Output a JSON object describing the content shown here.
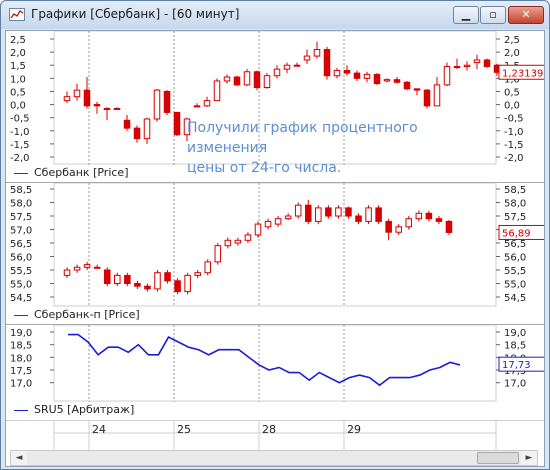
{
  "window": {
    "title": "Графики [Сбербанк] - [60 минут]",
    "minimize_glyph": "▁",
    "maximize_glyph": "▫",
    "close_glyph": "✕"
  },
  "annotation": {
    "line1": "Получили график процентного изменения",
    "line2": "цены от 24-го числа."
  },
  "colors": {
    "candle": "#d80000",
    "line": "#1c1cd8",
    "annotation": "#5b8fd6"
  },
  "time_axis": {
    "labels": [
      "24",
      "25",
      "28",
      "29"
    ]
  },
  "scroll": {
    "left_arrow": "◄",
    "right_arrow": "►"
  },
  "chart_data": [
    {
      "type": "candlestick",
      "legend": "Сбербанк [Price]",
      "last_value": "1,231394",
      "yticks": [
        "2,5",
        "2,0",
        "1,5",
        "1,0",
        "0,5",
        "0,0",
        "-0,5",
        "-1,0",
        "-1,5",
        "-2,0"
      ],
      "ylim": [
        -2.0,
        2.5
      ],
      "candles": [
        [
          0.15,
          0.3,
          0.5,
          0.05
        ],
        [
          0.3,
          0.55,
          0.8,
          0.15
        ],
        [
          0.55,
          -0.05,
          1.05,
          -0.15
        ],
        [
          0.0,
          -0.05,
          0.1,
          -0.35
        ],
        [
          -0.15,
          -0.15,
          -0.1,
          -0.6
        ],
        [
          -0.15,
          -0.15,
          -0.1,
          -0.15
        ],
        [
          -0.6,
          -0.9,
          -0.4,
          -1.0
        ],
        [
          -0.9,
          -1.3,
          -0.8,
          -1.45
        ],
        [
          -1.3,
          -0.55,
          -0.5,
          -1.5
        ],
        [
          -0.55,
          0.55,
          0.6,
          -0.65
        ],
        [
          0.5,
          -0.3,
          0.55,
          -0.4
        ],
        [
          -0.3,
          -1.15,
          -0.3,
          -1.2
        ],
        [
          -1.15,
          -0.55,
          -0.5,
          -1.4
        ],
        [
          -0.05,
          -0.05,
          0.05,
          -0.1
        ],
        [
          -0.05,
          0.15,
          0.3,
          -0.1
        ],
        [
          0.15,
          0.9,
          1.0,
          0.15
        ],
        [
          0.9,
          1.05,
          1.15,
          0.8
        ],
        [
          1.05,
          0.75,
          1.1,
          0.7
        ],
        [
          0.75,
          1.25,
          1.35,
          0.7
        ],
        [
          1.25,
          0.65,
          1.3,
          0.55
        ],
        [
          0.65,
          1.1,
          1.2,
          0.6
        ],
        [
          1.1,
          1.35,
          1.5,
          1.0
        ],
        [
          1.35,
          1.5,
          1.6,
          1.2
        ],
        [
          1.5,
          1.5,
          1.6,
          1.45
        ],
        [
          1.7,
          1.85,
          2.1,
          1.55
        ],
        [
          1.85,
          2.1,
          2.4,
          1.75
        ],
        [
          2.1,
          1.1,
          2.2,
          0.95
        ],
        [
          1.1,
          1.3,
          1.4,
          1.0
        ],
        [
          1.3,
          1.2,
          1.5,
          1.1
        ],
        [
          1.2,
          1.0,
          1.3,
          0.9
        ],
        [
          1.0,
          1.15,
          1.25,
          0.85
        ],
        [
          1.15,
          0.8,
          1.2,
          0.75
        ],
        [
          0.9,
          0.95,
          1.0,
          0.85
        ],
        [
          0.95,
          0.85,
          1.05,
          0.8
        ],
        [
          0.85,
          0.6,
          0.9,
          0.55
        ],
        [
          0.6,
          0.55,
          0.6,
          0.35
        ],
        [
          0.55,
          -0.05,
          0.6,
          -0.15
        ],
        [
          -0.05,
          0.75,
          1.05,
          -0.05
        ],
        [
          0.75,
          1.45,
          1.6,
          0.7
        ],
        [
          1.45,
          1.45,
          1.75,
          1.35
        ],
        [
          1.45,
          1.5,
          1.65,
          1.3
        ],
        [
          1.6,
          1.7,
          1.9,
          1.35
        ],
        [
          1.7,
          1.45,
          1.75,
          1.4
        ],
        [
          1.5,
          1.23,
          1.55,
          1.1
        ]
      ]
    },
    {
      "type": "candlestick",
      "legend": "Сбербанк-п [Price]",
      "last_value": "56,89",
      "yticks": [
        "58,5",
        "58,0",
        "57,5",
        "57,0",
        "56,5",
        "56,0",
        "55,5",
        "55,0",
        "54,5"
      ],
      "ylim": [
        54.5,
        58.5
      ],
      "candles": [
        [
          55.3,
          55.5,
          55.6,
          55.2
        ],
        [
          55.5,
          55.6,
          55.7,
          55.4
        ],
        [
          55.6,
          55.7,
          55.8,
          55.5
        ],
        [
          55.6,
          55.6,
          55.7,
          55.55
        ],
        [
          55.5,
          55.0,
          55.6,
          54.9
        ],
        [
          55.0,
          55.3,
          55.4,
          54.9
        ],
        [
          55.3,
          55.0,
          55.4,
          54.9
        ],
        [
          55.0,
          54.9,
          55.1,
          54.8
        ],
        [
          54.9,
          54.8,
          55.0,
          54.7
        ],
        [
          54.8,
          55.4,
          55.5,
          54.7
        ],
        [
          55.4,
          55.1,
          55.5,
          55.0
        ],
        [
          55.1,
          54.7,
          55.2,
          54.6
        ],
        [
          54.7,
          55.3,
          55.4,
          54.6
        ],
        [
          55.3,
          55.4,
          55.5,
          55.2
        ],
        [
          55.4,
          55.8,
          55.9,
          55.3
        ],
        [
          55.8,
          56.4,
          56.5,
          55.7
        ],
        [
          56.4,
          56.6,
          56.7,
          56.3
        ],
        [
          56.5,
          56.6,
          56.7,
          56.4
        ],
        [
          56.6,
          56.8,
          56.9,
          56.5
        ],
        [
          56.8,
          57.2,
          57.3,
          56.7
        ],
        [
          57.1,
          57.3,
          57.4,
          57.0
        ],
        [
          57.2,
          57.4,
          57.5,
          57.1
        ],
        [
          57.4,
          57.5,
          57.6,
          57.35
        ],
        [
          57.5,
          57.9,
          58.0,
          57.4
        ],
        [
          57.9,
          57.3,
          58.1,
          57.2
        ],
        [
          57.3,
          57.8,
          57.9,
          57.2
        ],
        [
          57.8,
          57.5,
          57.9,
          57.4
        ],
        [
          57.5,
          57.8,
          57.9,
          57.4
        ],
        [
          57.8,
          57.5,
          57.85,
          57.4
        ],
        [
          57.5,
          57.3,
          57.6,
          57.2
        ],
        [
          57.3,
          57.8,
          57.9,
          57.2
        ],
        [
          57.8,
          57.3,
          57.9,
          57.2
        ],
        [
          57.3,
          56.9,
          57.4,
          56.6
        ],
        [
          56.9,
          57.1,
          57.2,
          56.8
        ],
        [
          57.1,
          57.4,
          57.5,
          57.0
        ],
        [
          57.4,
          57.6,
          57.7,
          57.3
        ],
        [
          57.6,
          57.4,
          57.7,
          57.3
        ],
        [
          57.4,
          57.3,
          57.5,
          57.2
        ],
        [
          57.3,
          56.89,
          57.35,
          56.8
        ]
      ]
    },
    {
      "type": "line",
      "legend": "SRU5 [Арбитраж]",
      "last_value": "17,73",
      "yticks": [
        "19,0",
        "18,5",
        "18,0",
        "17,5",
        "17,0"
      ],
      "ylim": [
        16.75,
        19.0
      ],
      "values": [
        18.9,
        18.9,
        18.6,
        18.1,
        18.4,
        18.4,
        18.2,
        18.5,
        18.1,
        18.1,
        18.8,
        18.6,
        18.4,
        18.3,
        18.1,
        18.3,
        18.3,
        18.3,
        18.0,
        17.7,
        17.5,
        17.6,
        17.4,
        17.4,
        17.1,
        17.4,
        17.2,
        17.0,
        17.2,
        17.3,
        17.2,
        16.9,
        17.2,
        17.2,
        17.2,
        17.3,
        17.5,
        17.6,
        17.8,
        17.7
      ]
    }
  ]
}
